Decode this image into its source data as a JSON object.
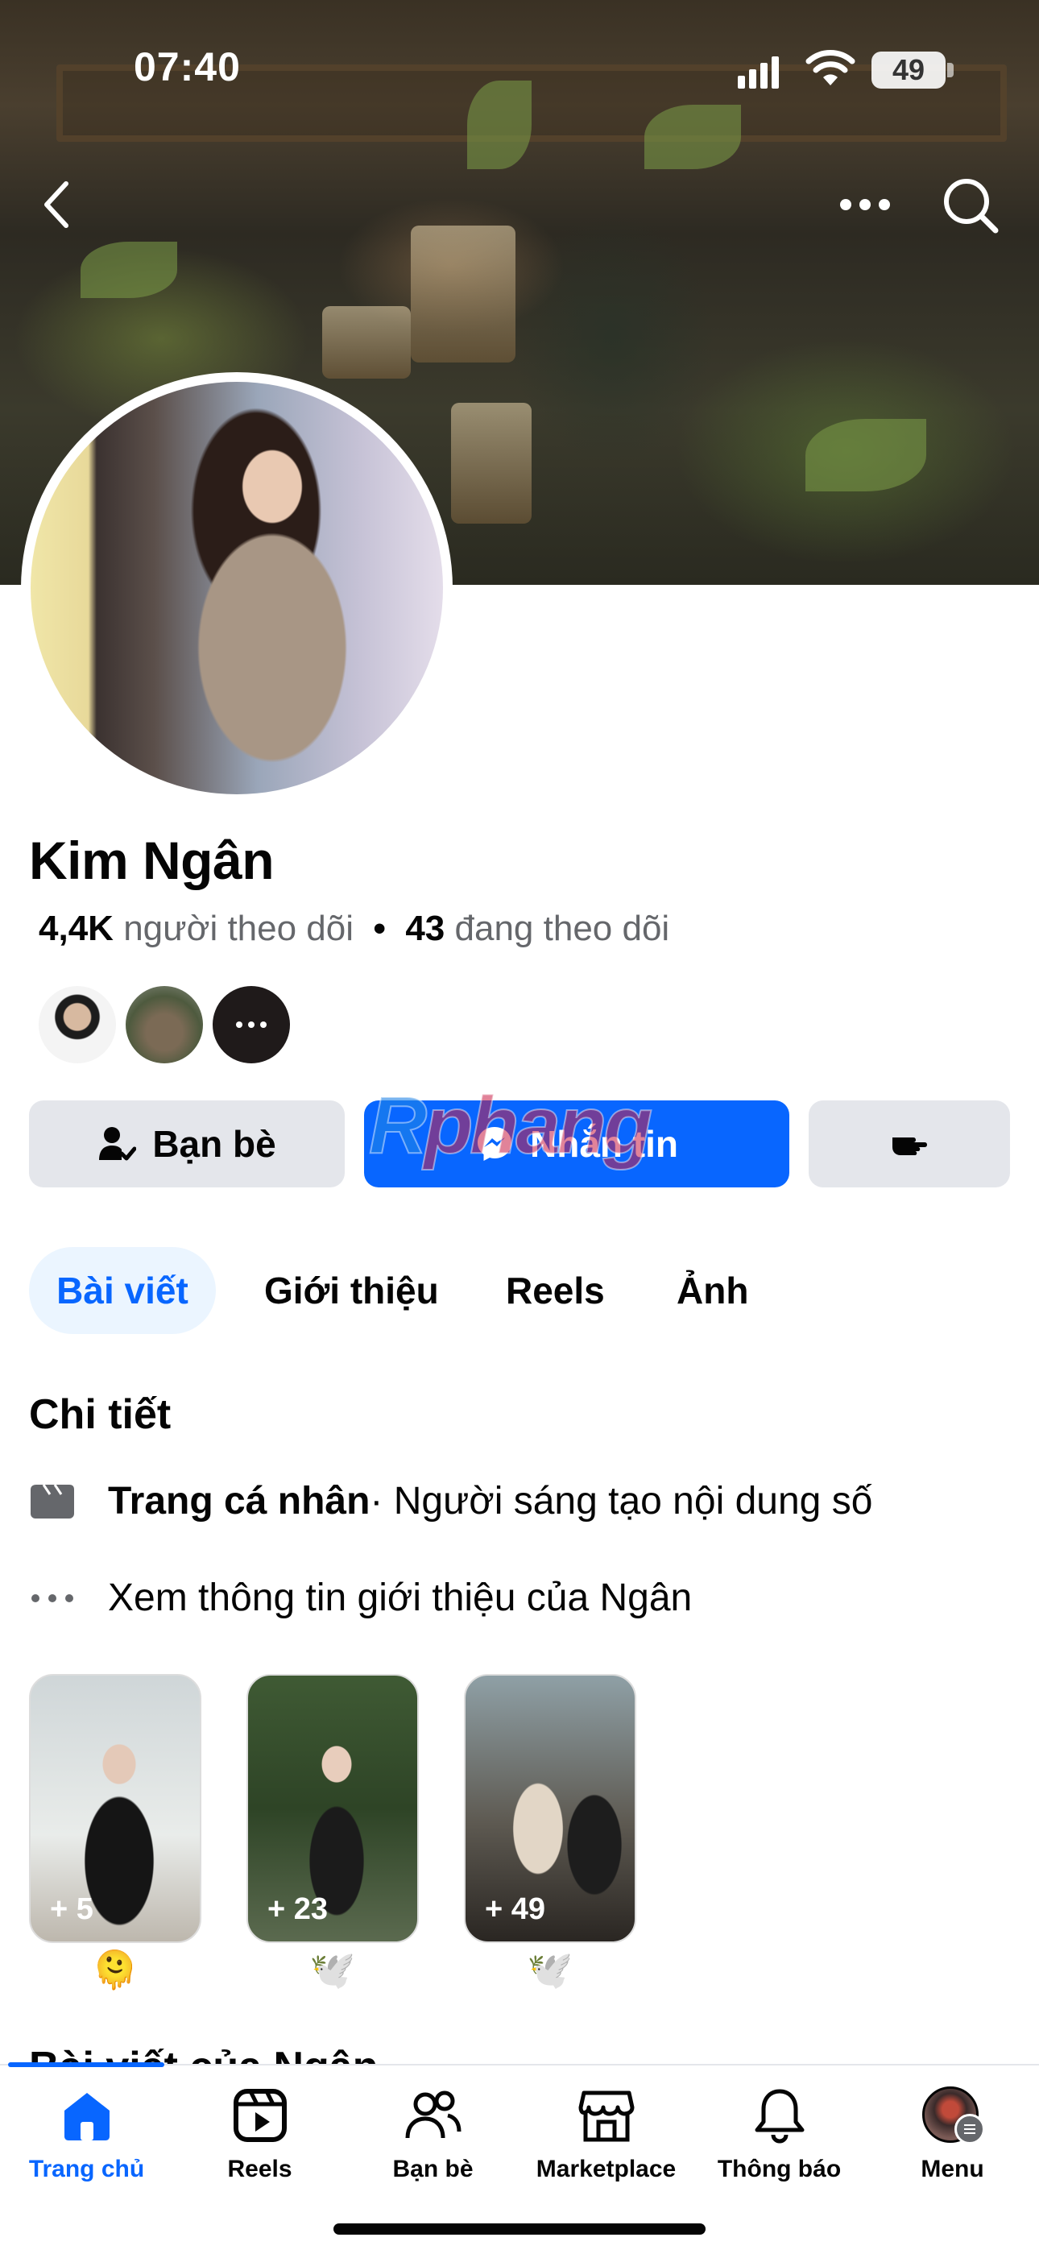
{
  "status": {
    "time": "07:40",
    "battery": "49"
  },
  "profile": {
    "name": "Kim Ngân",
    "followers_count": "4,4K",
    "followers_label": "người theo dõi",
    "separator": "•",
    "following_count": "43",
    "following_label": "đang theo dõi"
  },
  "actions": {
    "friends": "Bạn bè",
    "message": "Nhắn tin"
  },
  "watermark": {
    "part1": "R",
    "part2": "phang"
  },
  "tabs": [
    "Bài viết",
    "Giới thiệu",
    "Reels",
    "Ảnh"
  ],
  "details": {
    "title": "Chi tiết",
    "page_type_bold": "Trang cá nhân",
    "page_type_rest": " · Người sáng tạo nội dung số",
    "see_about": "Xem thông tin giới thiệu của Ngân"
  },
  "highlights": [
    {
      "count": "+ 5",
      "emoji": "🫠"
    },
    {
      "count": "+ 23",
      "emoji": "🕊️"
    },
    {
      "count": "+ 49",
      "emoji": "🕊️"
    }
  ],
  "next_section": "Bài viết của Ngân",
  "nav": [
    "Trang chủ",
    "Reels",
    "Bạn bè",
    "Marketplace",
    "Thông báo",
    "Menu"
  ],
  "colors": {
    "accent": "#0866ff",
    "button_gray": "#e4e6eb",
    "tab_active_bg": "#ebf5ff"
  }
}
